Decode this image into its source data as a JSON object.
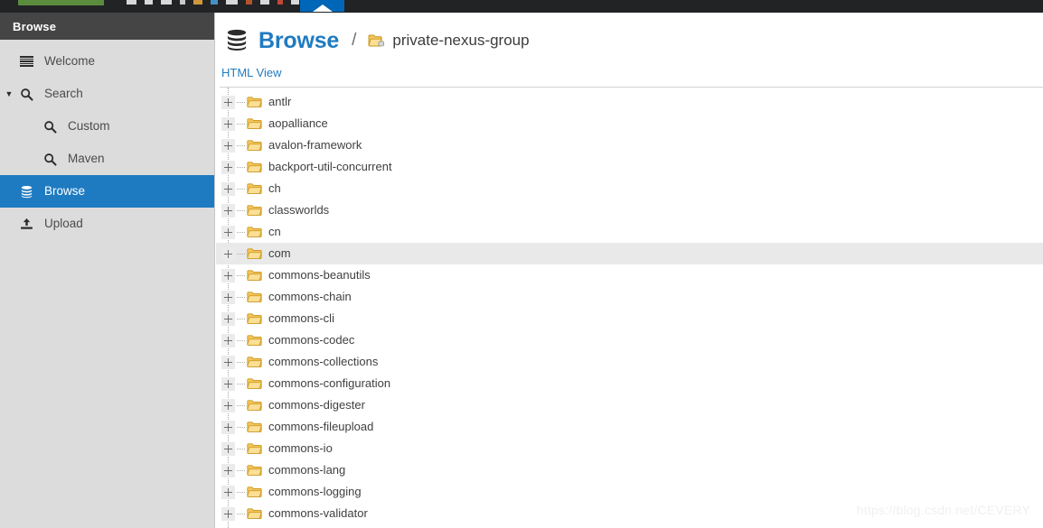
{
  "topbar": {
    "logo_color": "#5b8c3e",
    "background_color": "#222325",
    "active_tab_color": "#0067b8",
    "truncated": true
  },
  "sidebar": {
    "header_label": "Browse",
    "header_bg": "#454545",
    "panel_bg": "#dcdcdc",
    "selected_bg": "#1f7bc1",
    "items": [
      {
        "label": "Welcome",
        "icon": "lines-icon",
        "level": 0,
        "selected": false,
        "caret": ""
      },
      {
        "label": "Search",
        "icon": "search-icon",
        "level": 0,
        "selected": false,
        "caret": "▼"
      },
      {
        "label": "Custom",
        "icon": "search-icon",
        "level": 1,
        "selected": false,
        "caret": ""
      },
      {
        "label": "Maven",
        "icon": "search-icon",
        "level": 1,
        "selected": false,
        "caret": ""
      },
      {
        "label": "Browse",
        "icon": "database-icon",
        "level": 0,
        "selected": true,
        "caret": ""
      },
      {
        "label": "Upload",
        "icon": "upload-icon",
        "level": 0,
        "selected": false,
        "caret": ""
      }
    ]
  },
  "main": {
    "breadcrumb": {
      "icon": "database-icon",
      "title": "Browse",
      "separator": "/",
      "repo_icon": "repository-folder-icon",
      "repository": "private-nexus-group"
    },
    "html_view_link": "HTML View",
    "tree": {
      "expander_glyph": "+",
      "rows": [
        {
          "label": "antlr"
        },
        {
          "label": "aopalliance"
        },
        {
          "label": "avalon-framework"
        },
        {
          "label": "backport-util-concurrent"
        },
        {
          "label": "ch"
        },
        {
          "label": "classworlds"
        },
        {
          "label": "cn"
        },
        {
          "label": "com",
          "highlight": true
        },
        {
          "label": "commons-beanutils"
        },
        {
          "label": "commons-chain"
        },
        {
          "label": "commons-cli"
        },
        {
          "label": "commons-codec"
        },
        {
          "label": "commons-collections"
        },
        {
          "label": "commons-configuration"
        },
        {
          "label": "commons-digester"
        },
        {
          "label": "commons-fileupload"
        },
        {
          "label": "commons-io"
        },
        {
          "label": "commons-lang"
        },
        {
          "label": "commons-logging"
        },
        {
          "label": "commons-validator"
        }
      ]
    }
  },
  "watermark": {
    "text": "https://blog.csdn.net/CEVERY"
  }
}
